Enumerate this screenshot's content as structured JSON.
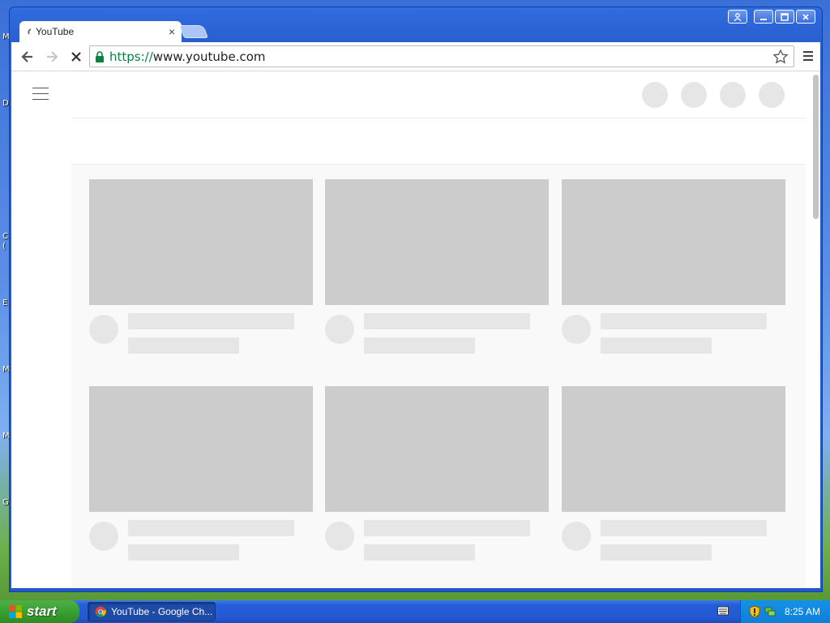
{
  "desktop": {
    "edge_letters": [
      "M",
      "D",
      "C",
      "(",
      "E",
      "M",
      "M",
      "G"
    ]
  },
  "browser": {
    "tab": {
      "title": "YouTube",
      "close_label": "×"
    },
    "address": {
      "scheme": "https://",
      "host": "www.youtube.com"
    }
  },
  "taskbar": {
    "start_label": "start",
    "window_item_label": "YouTube - Google Ch...",
    "clock": "8:25 AM"
  },
  "colors": {
    "accent": "#245edb",
    "start_green": "#38a12f",
    "placeholder": "#cccccc"
  }
}
